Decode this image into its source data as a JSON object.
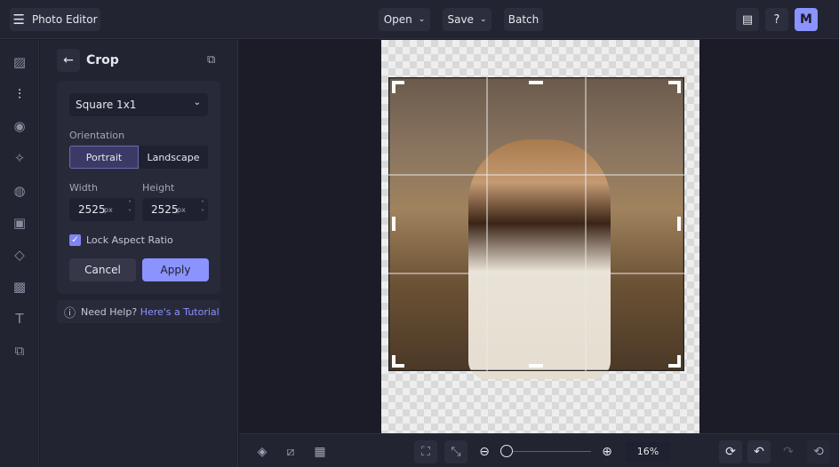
{
  "header": {
    "app_title": "Photo Editor",
    "open_label": "Open",
    "save_label": "Save",
    "batch_label": "Batch",
    "avatar_initial": "M"
  },
  "panel": {
    "title": "Crop",
    "preset": "Square 1x1",
    "orientation_label": "Orientation",
    "portrait_label": "Portrait",
    "landscape_label": "Landscape",
    "width_label": "Width",
    "height_label": "Height",
    "width_value": "2525",
    "height_value": "2525",
    "unit": "px",
    "lock_label": "Lock Aspect Ratio",
    "lock_checked": true,
    "cancel_label": "Cancel",
    "apply_label": "Apply",
    "help_text": "Need Help?",
    "help_link": "Here's a Tutorial"
  },
  "zoom": {
    "value": "16%",
    "fraction": 0.0
  },
  "colors": {
    "accent": "#8b93ff",
    "portrait_active": "#3b3a66"
  }
}
